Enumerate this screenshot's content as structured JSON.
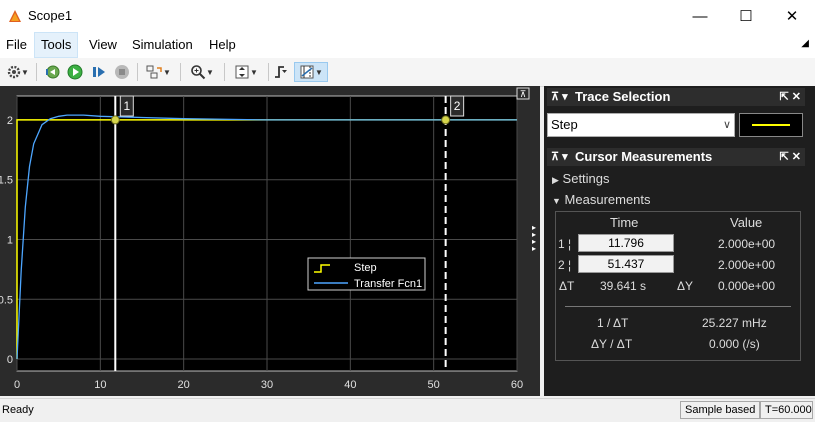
{
  "window": {
    "title": "Scope1",
    "minimize_glyph": "—",
    "maximize_glyph": "☐",
    "close_glyph": "✕"
  },
  "menu": {
    "items": [
      "File",
      "Tools",
      "View",
      "Simulation",
      "Help"
    ],
    "dock_glyph": "◢"
  },
  "toolbar": {
    "icons": [
      "gear-icon",
      "run-icon",
      "step-forward-icon",
      "stop-icon",
      "highlight-icon",
      "zoom-icon",
      "autoscale-icon",
      "triggers-icon",
      "cursor-measurements-icon"
    ]
  },
  "plot": {
    "y_ticks": [
      "0",
      "0.5",
      "1",
      "1.5",
      "2"
    ],
    "x_ticks": [
      "0",
      "10",
      "20",
      "30",
      "40",
      "50",
      "60"
    ],
    "cursor1_label": "1",
    "cursor2_label": "2",
    "legend": [
      "Step",
      "Transfer Fcn1"
    ],
    "colors": {
      "step": "#ffff00",
      "transfer": "#4da6ff",
      "axes_bg": "#000000",
      "grid": "#4a4a4a",
      "cursor": "#ffffff"
    },
    "collapse_glyph": "⊼",
    "expand_glyph": "▸"
  },
  "chart_data": {
    "type": "line",
    "xlim": [
      0,
      60
    ],
    "ylim": [
      -0.1,
      2.2
    ],
    "grid": true,
    "legend_position": "center-right",
    "series": [
      {
        "name": "Step",
        "x": [
          0,
          0,
          60
        ],
        "y": [
          0,
          2,
          2
        ]
      },
      {
        "name": "Transfer Fcn1",
        "x": [
          0,
          0.5,
          1,
          1.5,
          2,
          3,
          4,
          5,
          6,
          8,
          10,
          15,
          20,
          30,
          40,
          50,
          60
        ],
        "y": [
          0,
          0.74,
          1.27,
          1.61,
          1.8,
          1.96,
          2.01,
          2.03,
          2.04,
          2.04,
          2.03,
          2.02,
          2.01,
          2.0,
          2.0,
          2.0,
          2.0
        ]
      }
    ],
    "cursors": [
      11.796,
      51.437
    ]
  },
  "trace_selection": {
    "title": "Trace Selection",
    "selected": "Step",
    "pin_glyph": "⊼ ▾",
    "controls": "⇱ ✕"
  },
  "cursor_measurements": {
    "title": "Cursor Measurements",
    "pin_glyph": "⊼ ▾",
    "controls": "⇱ ✕",
    "settings_label": "Settings",
    "measurements_label": "Measurements",
    "collapsed_glyph": "▶",
    "expanded_glyph": "▼",
    "header_time": "Time",
    "header_value": "Value",
    "row1_label": "1 ¦",
    "row2_label": "2 ¦",
    "row1_time": "11.796",
    "row1_value": "2.000e+00",
    "row2_time": "51.437",
    "row2_value": "2.000e+00",
    "dt_label": "ΔT",
    "dt_value": "39.641 s",
    "dy_label": "ΔY",
    "dy_value": "0.000e+00",
    "inv_dt_label": "1 / ΔT",
    "inv_dt_value": "25.227 mHz",
    "slope_label": "ΔY / ΔT",
    "slope_value": "0.000 (/s)"
  },
  "status": {
    "ready": "Ready",
    "sample_based": "Sample based",
    "time": "T=60.000"
  }
}
